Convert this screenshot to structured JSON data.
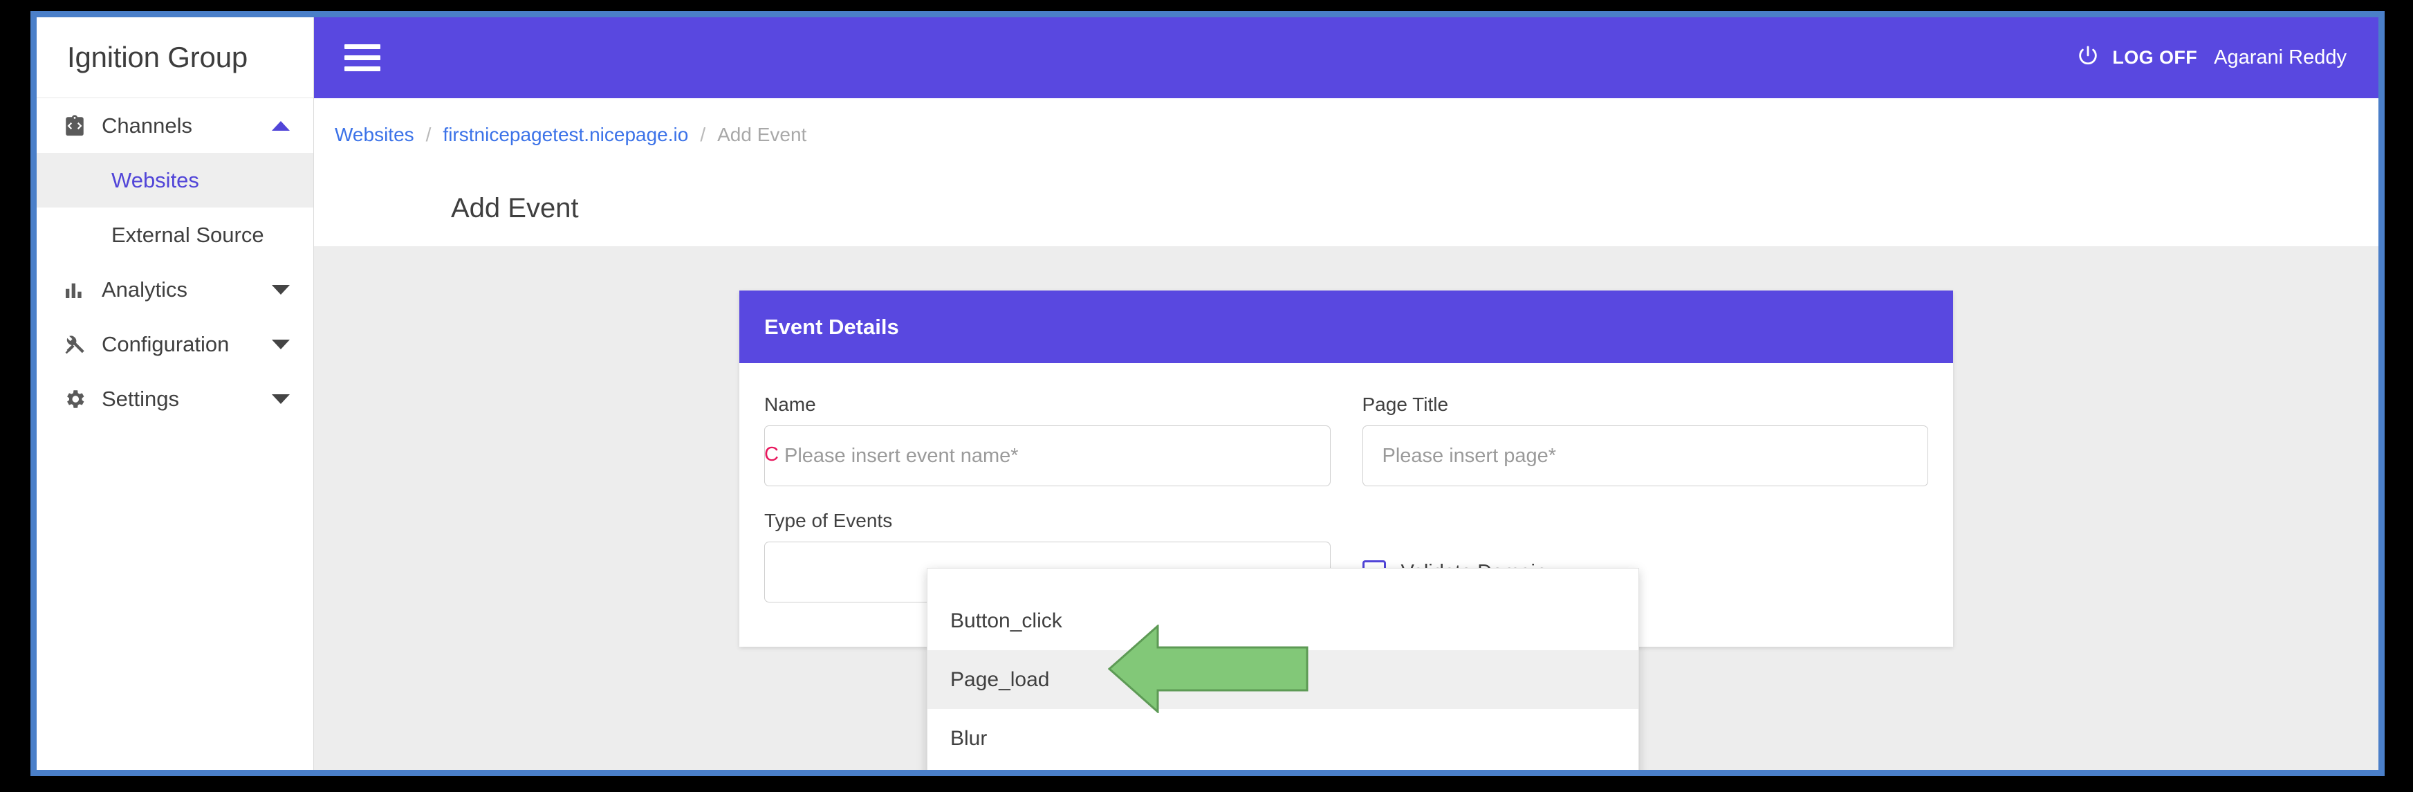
{
  "brand": {
    "title": "Ignition Group"
  },
  "sidebar": {
    "items": [
      {
        "label": "Channels",
        "icon": "code-clipboard-icon",
        "caret": "up",
        "type": "group"
      },
      {
        "label": "Websites",
        "icon": "",
        "type": "sub",
        "active": true
      },
      {
        "label": "External Source",
        "icon": "",
        "type": "sub",
        "active": false
      },
      {
        "label": "Analytics",
        "icon": "bar-chart-icon",
        "caret": "down",
        "type": "group"
      },
      {
        "label": "Configuration",
        "icon": "tools-icon",
        "caret": "down",
        "type": "group"
      },
      {
        "label": "Settings",
        "icon": "gear-icon",
        "caret": "down",
        "type": "group"
      }
    ]
  },
  "topbar": {
    "menu_icon": "hamburger-icon",
    "power_icon": "power-icon",
    "logoff_label": "LOG OFF",
    "user_name": "Agarani Reddy",
    "background_color": "#5948e0"
  },
  "breadcrumb": {
    "items": [
      {
        "label": "Websites",
        "current": false
      },
      {
        "label": "firstnicepagetest.nicepage.io",
        "current": false
      },
      {
        "label": "Add Event",
        "current": true
      }
    ],
    "separator": "/"
  },
  "page": {
    "title": "Add Event"
  },
  "card": {
    "header_title": "Event Details",
    "fields": {
      "name": {
        "label": "Name",
        "value": "",
        "placeholder": "Please insert event name*"
      },
      "page_title": {
        "label": "Page Title",
        "value": "",
        "placeholder": "Please insert page*"
      },
      "type_of_events": {
        "label": "Type of Events",
        "value": ""
      }
    },
    "checkbox": {
      "label": "Validate Domain",
      "checked": false
    },
    "cancel_label": "C",
    "accent_color": "#5948e0",
    "cancel_color": "#e8175d"
  },
  "dropdown": {
    "open": true,
    "options": [
      {
        "label": "Button_click",
        "highlighted": false
      },
      {
        "label": "Page_load",
        "highlighted": true
      },
      {
        "label": "Blur",
        "highlighted": false
      }
    ]
  },
  "annotation": {
    "arrow": "left-arrow-annotation",
    "fill_color": "#82c878",
    "stroke_color": "#5d9a55"
  }
}
